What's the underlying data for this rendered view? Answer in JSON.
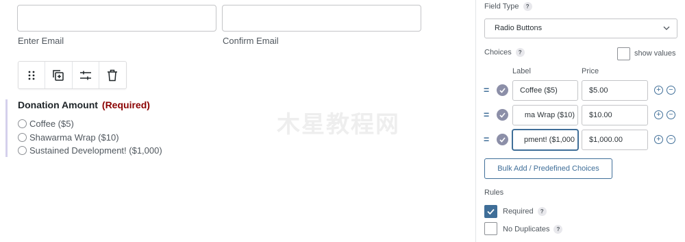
{
  "email": {
    "email_label": "Enter Email",
    "confirm_label": "Confirm Email"
  },
  "toolbar": {
    "buttons": [
      {
        "icon": "drag-handle-icon"
      },
      {
        "icon": "duplicate-icon"
      },
      {
        "icon": "settings-icon"
      },
      {
        "icon": "trash-icon"
      }
    ]
  },
  "field": {
    "title": "Donation Amount",
    "required_text": "(Required)",
    "required_color": "#8b0000",
    "options": [
      "Coffee ($5)",
      "Shawarma Wrap ($10)",
      "Sustained Development! ($1,000)"
    ]
  },
  "watermark": "木星教程网",
  "panel": {
    "field_type_label": "Field Type",
    "field_type_value": "Radio Buttons",
    "choices_label": "Choices",
    "show_values_label": "show values",
    "label_col": "Label",
    "price_col": "Price",
    "choices": [
      {
        "label": "Coffee ($5)",
        "price": "$5.00"
      },
      {
        "label": "ma Wrap ($10)",
        "price": "$10.00"
      },
      {
        "label": "pment! ($1,000",
        "price": "$1,000.00"
      }
    ],
    "bulk_button": "Bulk Add / Predefined Choices",
    "rules_label": "Rules",
    "required_label": "Required",
    "no_duplicates_label": "No Duplicates",
    "help_glyph": "?",
    "drag_glyph": "=",
    "plus_glyph": "+",
    "minus_glyph": "−",
    "accent_color": "#3f6e98"
  }
}
